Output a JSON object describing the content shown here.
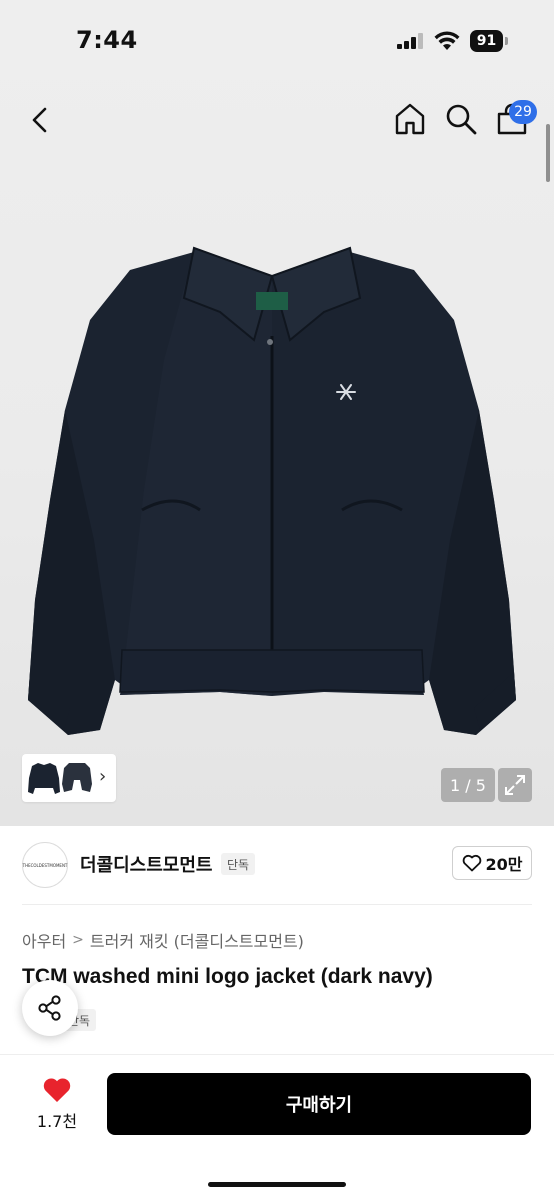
{
  "status_bar": {
    "time": "7:44",
    "battery": "91"
  },
  "header": {
    "icons": [
      "back-icon",
      "home-icon",
      "search-icon",
      "cart-icon"
    ],
    "cart_count": "29"
  },
  "gallery": {
    "counter": "1 / 5",
    "thumbnail_arrow": "›"
  },
  "seller": {
    "name": "더콜디스트모먼트",
    "badge": "단독",
    "logo_text": "THECOLDESTMOMENT",
    "likes": "20만"
  },
  "product": {
    "breadcrumb": [
      "아우터",
      "트러커 재킷 (더콜디스트모먼트)"
    ],
    "title": "TCM washed mini logo jacket (dark navy)",
    "badge": "단독"
  },
  "bottom_bar": {
    "like_count": "1.7천",
    "buy_label": "구매하기"
  },
  "colors": {
    "accent": "#2f6fe8",
    "heart": "#e8242d",
    "buy_button": "#000000",
    "jacket": "#1b2330"
  }
}
